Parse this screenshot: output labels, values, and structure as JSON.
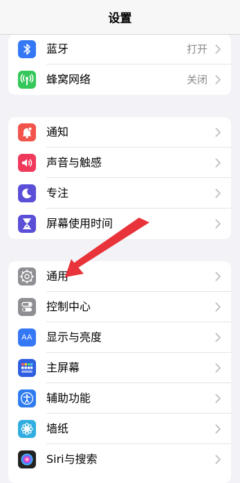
{
  "nav": {
    "title": "设置"
  },
  "group1": {
    "bluetooth": {
      "label": "蓝牙",
      "value": "打开",
      "icon": "bluetooth-icon",
      "color": "#3478f6"
    },
    "cellular": {
      "label": "蜂窝网络",
      "value": "关闭",
      "icon": "antenna-icon",
      "color": "#34c759"
    }
  },
  "group2": {
    "notifications": {
      "label": "通知",
      "icon": "bell-icon",
      "color": "#f2544b"
    },
    "sounds": {
      "label": "声音与触感",
      "icon": "speaker-icon",
      "color": "#f03a5b"
    },
    "focus": {
      "label": "专注",
      "icon": "moon-icon",
      "color": "#5a4fd6"
    },
    "screentime": {
      "label": "屏幕使用时间",
      "icon": "hourglass-icon",
      "color": "#5a4fd6"
    }
  },
  "group3": {
    "general": {
      "label": "通用",
      "icon": "gear-icon",
      "color": "#8e8e93"
    },
    "control": {
      "label": "控制中心",
      "icon": "toggles-icon",
      "color": "#8e8e93"
    },
    "display": {
      "label": "显示与亮度",
      "icon": "text-size-icon",
      "color": "#3478f6",
      "glyph": "AA"
    },
    "home": {
      "label": "主屏幕",
      "icon": "app-grid-icon",
      "color": "#2f5fe0"
    },
    "access": {
      "label": "辅助功能",
      "icon": "accessibility-icon",
      "color": "#2f7cf0"
    },
    "wallpaper": {
      "label": "墙纸",
      "icon": "flower-icon",
      "color": "#31aee0"
    },
    "siri": {
      "label": "Siri与搜索",
      "icon": "siri-icon",
      "color": "#222222"
    }
  },
  "annotation": {
    "arrow_color": "#e8333a",
    "points_to": "通用"
  }
}
